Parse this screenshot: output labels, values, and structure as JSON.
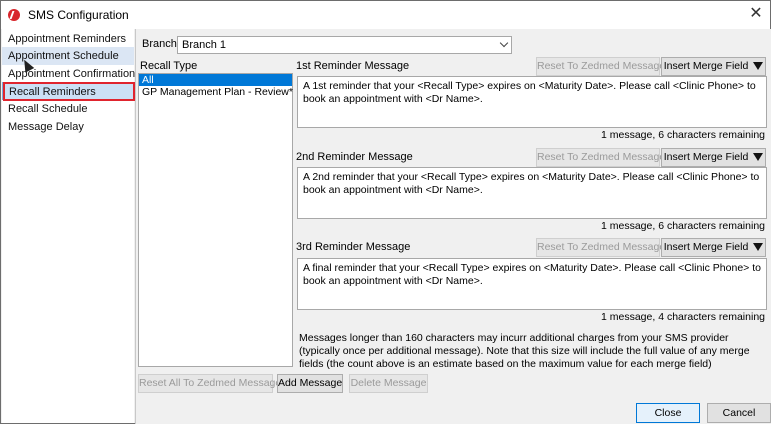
{
  "window": {
    "title": "SMS Configuration",
    "close_glyph": "✕"
  },
  "sidebar": {
    "items": [
      {
        "label": "Appointment Reminders"
      },
      {
        "label": "Appointment Schedule"
      },
      {
        "label": "Appointment Confirmation"
      },
      {
        "label": "Recall Reminders"
      },
      {
        "label": "Recall Schedule"
      },
      {
        "label": "Message Delay"
      }
    ],
    "selected_index": 3
  },
  "branch": {
    "label": "Branch:",
    "value": "Branch 1"
  },
  "recall_type": {
    "label": "Recall Type",
    "items": [
      "All",
      "GP Management Plan - Review*"
    ],
    "selected_index": 0
  },
  "reminders": [
    {
      "label": "1st Reminder Message",
      "text": "A 1st reminder that your <Recall Type> expires on <Maturity Date>. Please call <Clinic Phone> to book an appointment with <Dr Name>.",
      "counter": "1 message, 6 characters remaining",
      "reset_label": "Reset To Zedmed Message",
      "merge_label": "Insert Merge Field"
    },
    {
      "label": "2nd Reminder Message",
      "text": "A 2nd reminder that your <Recall Type> expires on <Maturity Date>. Please call <Clinic Phone> to book an appointment with <Dr Name>.",
      "counter": "1 message, 6 characters remaining",
      "reset_label": "Reset To Zedmed Message",
      "merge_label": "Insert Merge Field"
    },
    {
      "label": "3rd Reminder Message",
      "text": "A final reminder that your <Recall Type> expires on <Maturity Date>. Please call <Clinic Phone> to book an appointment with <Dr Name>.",
      "counter": "1 message, 4 characters remaining",
      "reset_label": "Reset To Zedmed Message",
      "merge_label": "Insert Merge Field"
    }
  ],
  "note": "Messages longer than 160 characters may incurr additional charges from your SMS provider (typically once per additional message). Note that this size will include the full value of any merge fields (the count above is an estimate based on the maximum value for each merge field)",
  "bottom_buttons": {
    "reset_all": "Reset All To Zedmed Message",
    "add": "Add Message",
    "delete": "Delete Message"
  },
  "footer": {
    "close": "Close",
    "cancel": "Cancel"
  },
  "colors": {
    "selection": "#0078d7",
    "highlight_box": "#e0242e",
    "app_icon": "#d8262c"
  },
  "icons": {
    "app": "zedmed-logo-icon",
    "dropdown": "chevron-down-icon",
    "merge": "triangle-down-icon",
    "close": "close-icon"
  }
}
